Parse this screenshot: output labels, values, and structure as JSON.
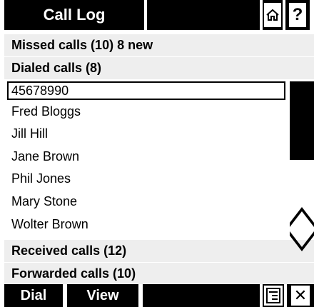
{
  "header": {
    "title": "Call Log",
    "help_label": "?",
    "home_icon": "home-icon"
  },
  "list": {
    "sections": {
      "missed": "Missed calls (10) 8 new",
      "dialed": "Dialed calls (8)",
      "received": "Received calls (12)",
      "forwarded": "Forwarded calls (10)"
    },
    "dialed_items": [
      "45678990",
      "Fred Bloggs",
      "Jill Hill",
      "Jane Brown",
      "Phil Jones",
      "Mary Stone",
      "Wolter Brown"
    ]
  },
  "footer": {
    "dial_label": "Dial",
    "view_label": "View",
    "close_label": "✕",
    "menu_icon": "menu-icon"
  }
}
